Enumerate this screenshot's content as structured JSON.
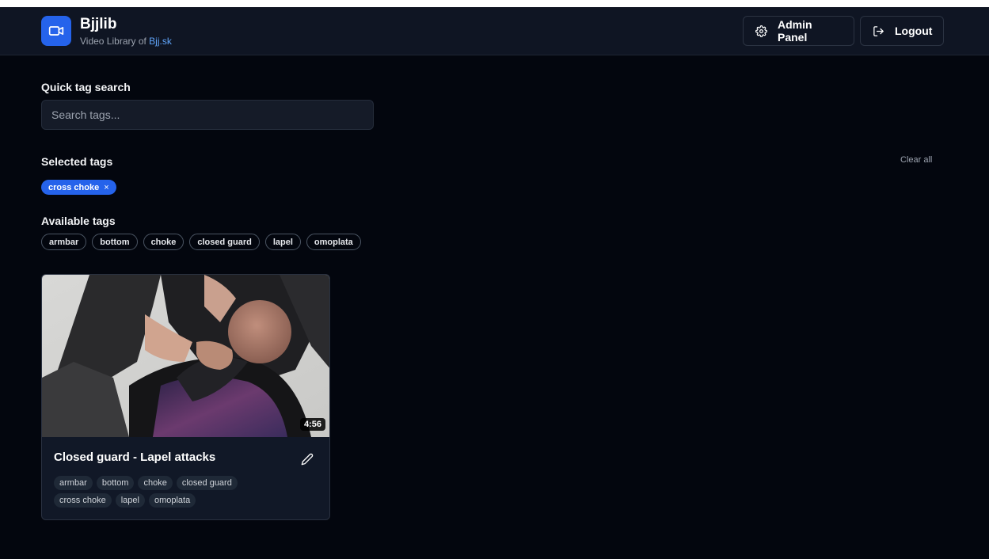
{
  "header": {
    "app_title": "Bjjlib",
    "subtitle_prefix": "Video Library of ",
    "subtitle_link": "Bjj.sk",
    "admin_label": "Admin Panel",
    "logout_label": "Logout"
  },
  "search": {
    "label": "Quick tag search",
    "placeholder": "Search tags..."
  },
  "selected": {
    "label": "Selected tags",
    "clear_label": "Clear all",
    "tags": [
      "cross choke"
    ],
    "remove_glyph": "×"
  },
  "available": {
    "label": "Available tags",
    "tags": [
      "armbar",
      "bottom",
      "choke",
      "closed guard",
      "lapel",
      "omoplata"
    ]
  },
  "videos": [
    {
      "title": "Closed guard - Lapel attacks",
      "duration": "4:56",
      "tags": [
        "armbar",
        "bottom",
        "choke",
        "closed guard",
        "cross choke",
        "lapel",
        "omoplata"
      ]
    }
  ],
  "icons": {
    "logo": "video-camera-icon",
    "admin": "gear-icon",
    "logout": "logout-icon",
    "edit": "pencil-icon"
  },
  "colors": {
    "accent": "#2563eb",
    "link": "#60a5fa",
    "background": "#03060e",
    "header": "#0f1523"
  }
}
